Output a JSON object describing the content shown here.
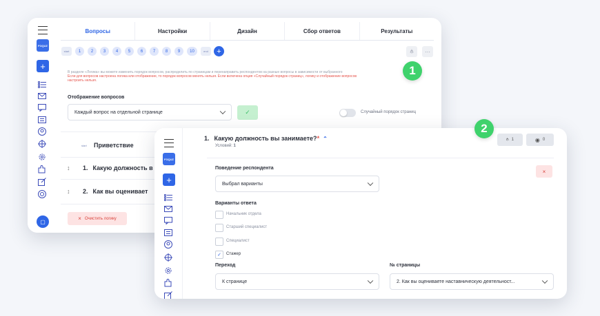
{
  "tabs": [
    "Вопросы",
    "Настройки",
    "Дизайн",
    "Сбор ответов",
    "Результаты"
  ],
  "pages": {
    "start": "start",
    "numbers": [
      "1",
      "2",
      "3",
      "4",
      "5",
      "6",
      "7",
      "8",
      "9",
      "10"
    ],
    "end": "end",
    "add": "+"
  },
  "logo_text": "FOQUZ",
  "info": {
    "line1": "В разделе «Логика» вы можете изменить порядок вопросов, распределить по страницам и перенаправить респондентов на разные вопросы в зависимости от выбранного",
    "line2": "Если для вопросов настроена логика или отображение, то порядок вопросов менять нельзя. Если включена опция «Случайный порядок страниц», логику и отображение вопросов",
    "line3": "настроить нельзя."
  },
  "display": {
    "label": "Отображение вопросов",
    "value": "Каждый вопрос на отдельной странице",
    "random_label": "Случайный порядок страниц"
  },
  "list": {
    "start_tag": "start",
    "greeting": "Приветствие",
    "q1": {
      "num": "1.",
      "text": "Какую должность в"
    },
    "q2": {
      "num": "2.",
      "text": "Как вы оценивает"
    }
  },
  "reset_label": "Очистить логику",
  "badges": {
    "one": "1",
    "two": "2"
  },
  "question": {
    "num": "1.",
    "title": "Какую должность вы занимаете?",
    "required": "*",
    "conditions_label": "Условий:",
    "conditions_count": "1",
    "logic_count": "1",
    "view_count": "0"
  },
  "behavior": {
    "label": "Поведение респондента",
    "value": "Выбрал варианты"
  },
  "answers": {
    "label": "Варианты ответа",
    "options": [
      {
        "text": "Начальник отдела",
        "checked": false
      },
      {
        "text": "Старший специалист",
        "checked": false
      },
      {
        "text": "Специалист",
        "checked": false
      },
      {
        "text": "Стажер",
        "checked": true
      }
    ]
  },
  "transition": {
    "label": "Переход",
    "value": "К странице"
  },
  "page_no": {
    "label": "№ страницы",
    "value": "2. Как вы оцениваете наставническую деятельност..."
  },
  "colors": {
    "accent": "#2f66e6",
    "success": "#3fd26c",
    "danger": "#d9433b"
  }
}
